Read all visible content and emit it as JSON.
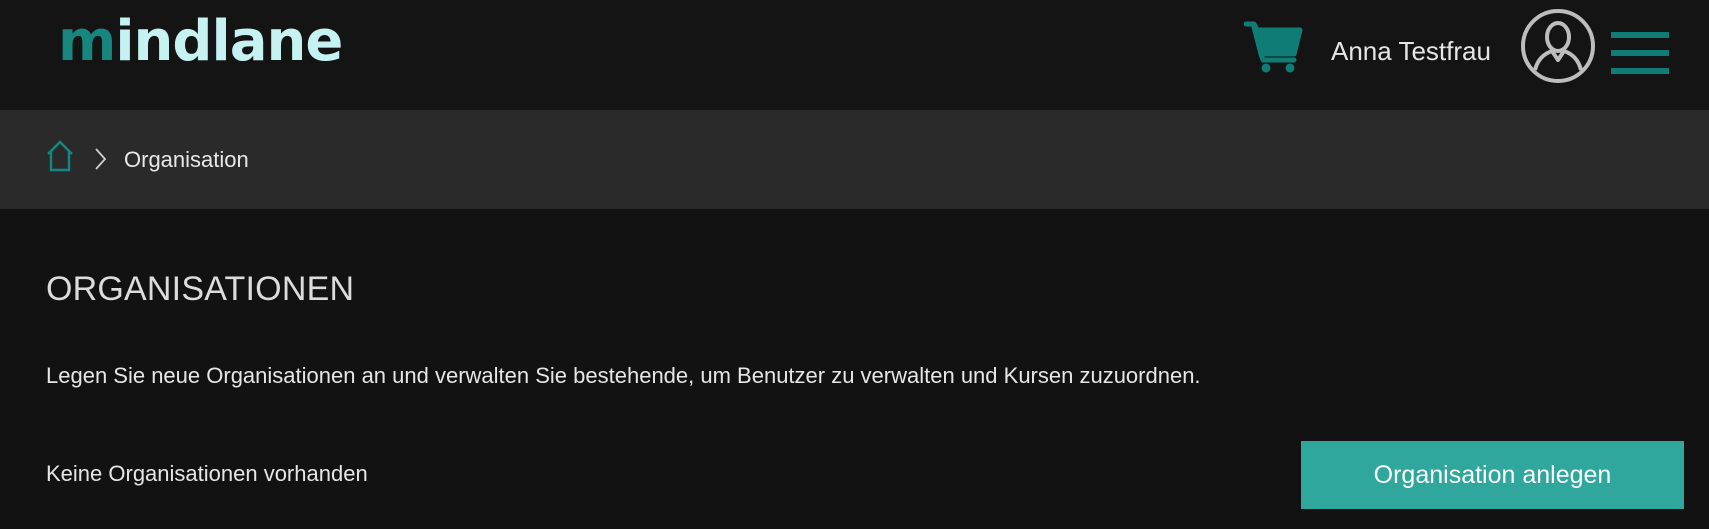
{
  "header": {
    "logo_prefix": "m",
    "logo_rest": "indlane",
    "cart_icon": "shopping-cart-icon",
    "user_name": "Anna Testfrau",
    "avatar_icon": "user-avatar-icon",
    "menu_icon": "hamburger-menu-icon"
  },
  "breadcrumb": {
    "home_icon": "home-icon",
    "separator_icon": "chevron-right-icon",
    "current": "Organisation"
  },
  "main": {
    "title": "ORGANISATIONEN",
    "description": "Legen Sie neue Organisationen an und verwalten Sie bestehende, um Benutzer zu verwalten und Kursen zuzuordnen.",
    "empty_message": "Keine Organisationen vorhanden",
    "create_button_label": "Organisation anlegen"
  },
  "colors": {
    "accent": "#0f7d76",
    "button": "#2fa79d",
    "header_bg": "#141414",
    "breadcrumb_bg": "#2a2a2a",
    "page_bg": "#121212",
    "logo_text": "#c6f2f2"
  }
}
